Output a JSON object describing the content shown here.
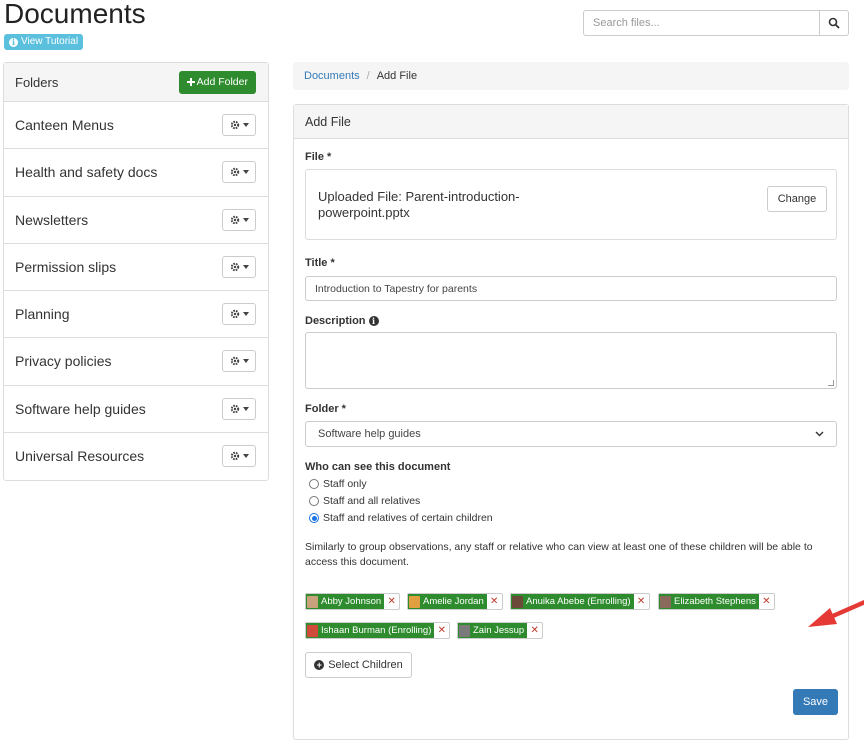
{
  "header": {
    "title": "Documents",
    "tutorial_label": "View Tutorial",
    "search_placeholder": "Search files..."
  },
  "sidebar": {
    "title": "Folders",
    "add_folder_label": "Add Folder",
    "folders": [
      "Canteen Menus",
      "Health and safety docs",
      "Newsletters",
      "Permission slips",
      "Planning",
      "Privacy policies",
      "Software help guides",
      "Universal Resources"
    ]
  },
  "breadcrumb": {
    "root": "Documents",
    "current": "Add File"
  },
  "form": {
    "heading": "Add File",
    "file_label": "File *",
    "uploaded_text": "Uploaded File: Parent-introduction-powerpoint.pptx",
    "change_label": "Change",
    "title_label": "Title *",
    "title_value": "Introduction to Tapestry for parents",
    "description_label": "Description",
    "folder_label": "Folder *",
    "folder_value": "Software help guides",
    "visibility_label": "Who can see this document",
    "visibility_options": [
      "Staff only",
      "Staff and all relatives",
      "Staff and relatives of certain children"
    ],
    "visibility_selected": 2,
    "help_text": "Similarly to group observations, any staff or relative who can view at least one of these children will be able to access this document.",
    "children": [
      "Abby Johnson",
      "Amelie Jordan",
      "Anuika Abebe (Enrolling)",
      "Elizabeth Stephens",
      "Ishaan Burman (Enrolling)",
      "Zain Jessup"
    ],
    "select_children_label": "Select Children",
    "save_label": "Save"
  },
  "colors": {
    "primary": "#337ab7",
    "success": "#2e8b2e",
    "info": "#5bc0de",
    "annotation": "#e53935"
  },
  "icons": {
    "search": "search-icon",
    "gear": "gear-icon",
    "info": "info-icon",
    "plus": "plus-icon",
    "remove": "remove-icon",
    "arrow": "annotation-arrow-icon"
  }
}
